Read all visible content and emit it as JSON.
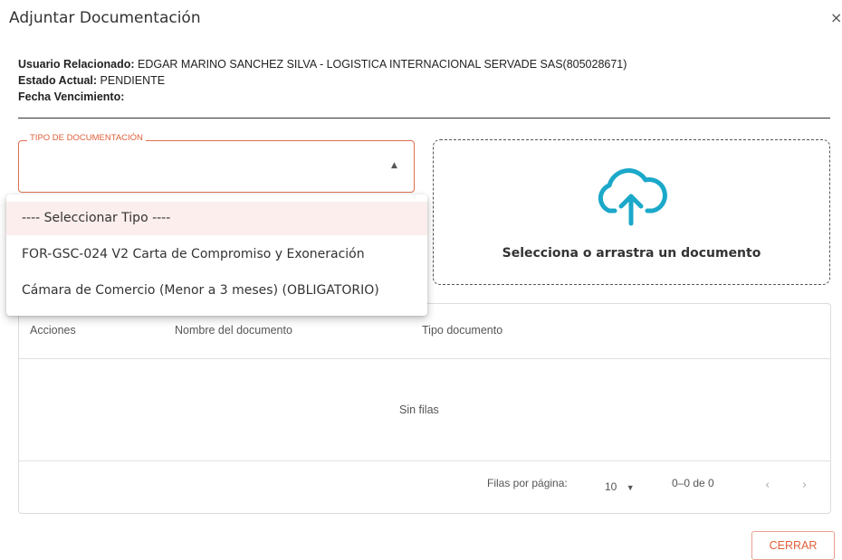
{
  "dialog": {
    "title": "Adjuntar Documentación",
    "close_glyph": "×"
  },
  "info": {
    "usuario_label": "Usuario Relacionado:",
    "usuario_value": "EDGAR MARINO SANCHEZ SILVA - LOGISTICA INTERNACIONAL SERVADE SAS(805028671)",
    "estado_label": "Estado Actual:",
    "estado_value": "PENDIENTE",
    "fecha_label": "Fecha Vencimiento:",
    "fecha_value": ""
  },
  "select": {
    "label": "TIPO DE DOCUMENTACIÓN",
    "value": "",
    "caret": "▲",
    "options": [
      "---- Seleccionar Tipo ----",
      "FOR-GSC-024 V2 Carta de Compromiso y Exoneración",
      "Cámara de Comercio (Menor a 3 meses) (OBLIGATORIO)"
    ]
  },
  "dropzone": {
    "icon": "cloud-upload-icon",
    "text": "Selecciona o arrastra un documento"
  },
  "table": {
    "columns": [
      "Acciones",
      "Nombre del documento",
      "Tipo documento"
    ],
    "empty_text": "Sin filas",
    "pagination": {
      "rows_label": "Filas por página:",
      "rows_value": "10",
      "range": "0–0 de 0",
      "prev": "‹",
      "next": "›"
    }
  },
  "footer": {
    "close_button": "CERRAR"
  },
  "colors": {
    "accent": "#e0603a",
    "upload_icon": "#1ba8c9"
  }
}
